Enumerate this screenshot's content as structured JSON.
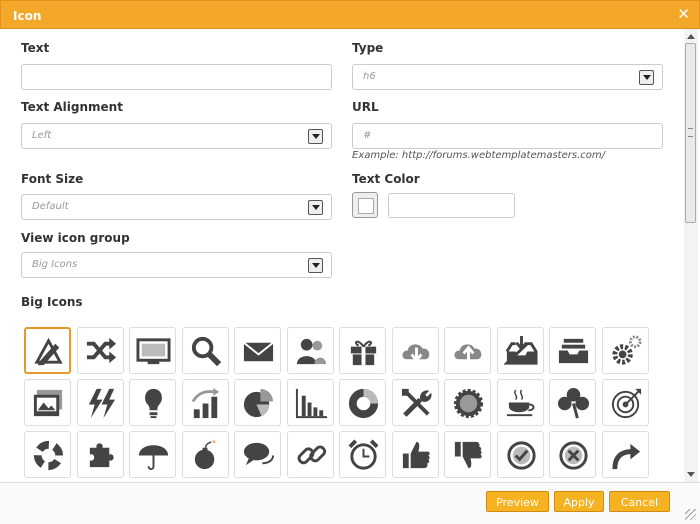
{
  "dialog": {
    "title": "Icon"
  },
  "form": {
    "text_label": "Text",
    "text_value": "",
    "type_label": "Type",
    "type_value": "h6",
    "alignment_label": "Text Alignment",
    "alignment_value": "Left",
    "url_label": "URL",
    "url_value": "#",
    "url_example": "Example: http://forums.webtemplatemasters.com/",
    "font_size_label": "Font Size",
    "font_size_value": "Default",
    "text_color_label": "Text Color",
    "text_color_value": "",
    "view_group_label": "View icon group",
    "view_group_value": "Big Icons"
  },
  "icons": {
    "section_title": "Big Icons",
    "rows": [
      [
        "pencil-ruler-icon",
        "shuffle-icon",
        "monitor-icon",
        "magnifier-icon",
        "envelope-icon",
        "users-icon",
        "gift-icon",
        "cloud-download-icon",
        "cloud-upload-icon",
        "inbox-download-icon",
        "inbox-tray-icon",
        "gears-icon"
      ],
      [
        "pictures-icon",
        "lightning-icon",
        "lightbulb-icon",
        "bar-growth-icon",
        "pie-chart-icon",
        "bar-chart-icon",
        "donut-chart-icon",
        "tools-icon",
        "badge-icon",
        "coffee-icon",
        "clover-icon",
        "target-icon"
      ],
      [
        "lifebuoy-icon",
        "puzzle-icon",
        "umbrella-icon",
        "bomb-icon",
        "speech-bubbles-icon",
        "link-icon",
        "alarm-clock-icon",
        "thumbs-up-icon",
        "thumbs-down-icon",
        "check-circle-icon",
        "cancel-circle-icon",
        "redo-arrow-icon"
      ]
    ],
    "selected": "pencil-ruler-icon"
  },
  "footer": {
    "preview_label": "Preview",
    "apply_label": "Apply",
    "cancel_label": "Cancel"
  },
  "colors": {
    "accent": "#f4a829",
    "icon_fill": "#444444",
    "selected_border": "#e49a2a"
  }
}
